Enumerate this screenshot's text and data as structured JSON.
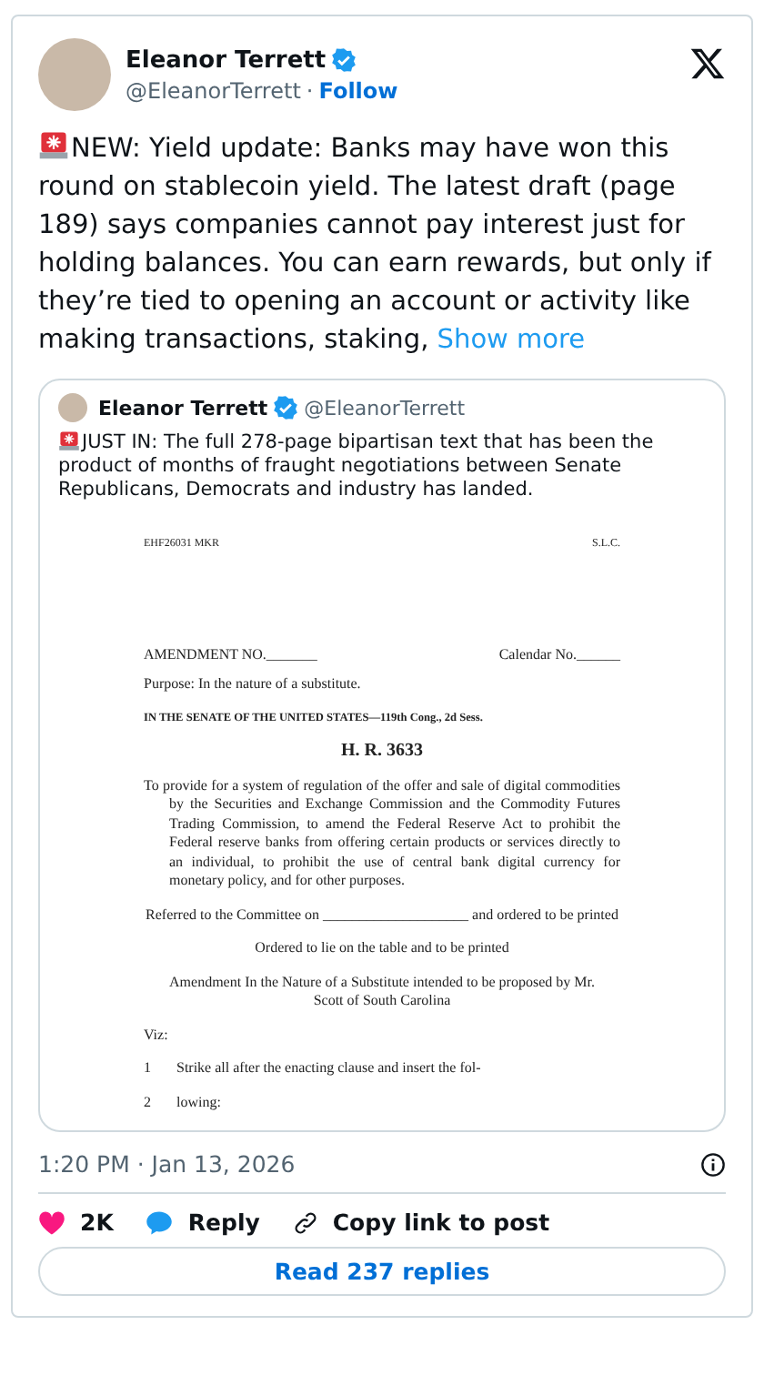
{
  "author": {
    "name": "Eleanor Terrett",
    "verified": true,
    "handle": "@EleanorTerrett",
    "separator": "·",
    "follow": "Follow"
  },
  "post": {
    "text": "NEW: Yield update: Banks may have won this round on stablecoin yield. The latest draft (page 189) says companies cannot pay interest just for holding balances. You can earn rewards, but only if they’re tied to opening an account or activity like making transactions, staking,",
    "show_more": "Show more"
  },
  "quote": {
    "name": "Eleanor Terrett",
    "verified": true,
    "handle": "@EleanorTerrett",
    "text": "JUST IN: The full 278-page bipartisan text that has been the product of months of fraught negotiations between Senate Republicans, Democrats and industry has landed.",
    "document": {
      "header_left": "EHF26031 MKR",
      "header_right": "S.L.C.",
      "amendment": "AMENDMENT NO._______",
      "calendar": "Calendar No.______",
      "purpose": "Purpose: In the nature of a substitute.",
      "senate": "IN THE SENATE OF THE UNITED STATES—119th Cong., 2d Sess.",
      "bill": "H. R. 3633",
      "title": "To provide for a system of regulation of the offer and sale of digital commodities by the Securities and Exchange Commission and the Commodity Futures Trading Commission, to amend the Federal Reserve Act to prohibit the Federal reserve banks from offering certain products or services directly to an individual, to prohibit the use of central bank digital currency for monetary policy, and for other purposes.",
      "referred": "Referred to the Committee on ____________________ and ordered to be printed",
      "ordered": "Ordered to lie on the table and to be printed",
      "nature": "Amendment In the Nature of a Substitute intended to be proposed by Mr. Scott of South Carolina",
      "viz": "Viz:",
      "lines": [
        {
          "number": "1",
          "text": "Strike all after the enacting clause and insert the fol-"
        },
        {
          "number": "2",
          "text": "lowing:"
        }
      ]
    }
  },
  "timestamp": "1:20 PM · Jan 13, 2026",
  "actions": {
    "likes": "2K",
    "reply": "Reply",
    "copy_link": "Copy link to post"
  },
  "read_replies": "Read 237 replies"
}
